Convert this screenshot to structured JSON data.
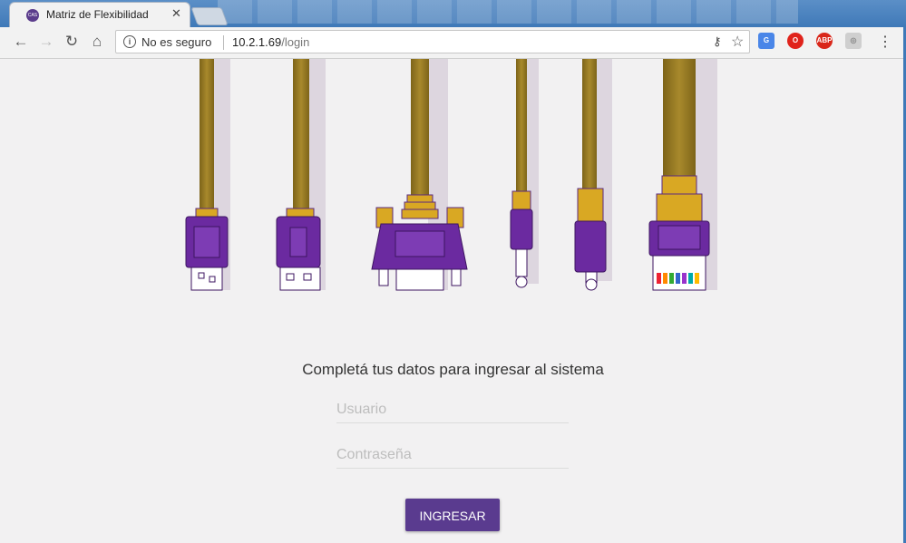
{
  "browser": {
    "tab_title": "Matriz de Flexibilidad",
    "tab_favicon_text": "CAS",
    "security_label": "No es seguro",
    "url_host": "10.2.1.69",
    "url_path": "/login",
    "extensions": [
      {
        "name": "translate-icon",
        "color": "#4a86e8",
        "label": "G"
      },
      {
        "name": "opera-icon",
        "color": "#e0231b",
        "label": "O"
      },
      {
        "name": "adblock-icon",
        "color": "#d9271a",
        "label": "ABP"
      },
      {
        "name": "extension-icon",
        "color": "#cfcfcf",
        "label": "◎"
      }
    ]
  },
  "login": {
    "heading": "Completá tus datos para ingresar al sistema",
    "username_placeholder": "Usuario",
    "password_placeholder": "Contraseña",
    "submit_label": "INGRESAR"
  },
  "colors": {
    "accent": "#5a3b8f",
    "cable": "#9a7d28",
    "connector": "#6b2aa0",
    "gold": "#d9a823"
  }
}
